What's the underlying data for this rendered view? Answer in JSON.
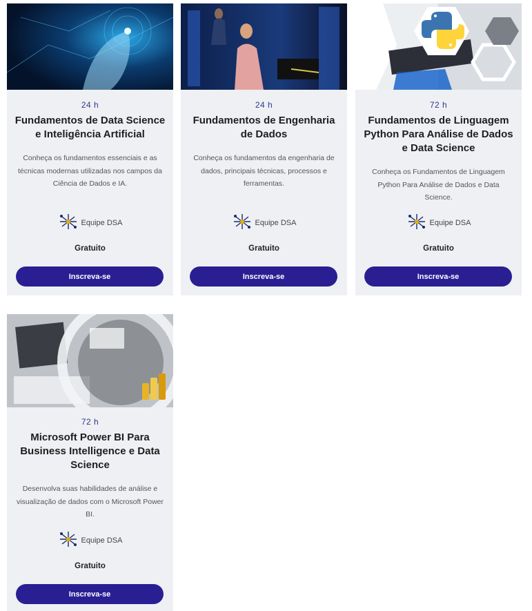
{
  "courses": [
    {
      "hours": "24 h",
      "title": "Fundamentos de Data Science e Inteligência Artificial",
      "description": "Conheça os fundamentos essenciais e as técnicas modernas utilizadas nos campos da Ciência de Dados e IA.",
      "author": "Equipe DSA",
      "price": "Gratuito",
      "cta": "Inscreva-se"
    },
    {
      "hours": "24 h",
      "title": "Fundamentos de Engenharia de Dados",
      "description": "Conheça os fundamentos da engenharia de dados, principais técnicas, processos e ferramentas.",
      "author": "Equipe DSA",
      "price": "Gratuito",
      "cta": "Inscreva-se"
    },
    {
      "hours": "72 h",
      "title": "Fundamentos de Linguagem Python Para Análise de Dados e Data Science",
      "description": "Conheça os Fundamentos de Linguagem Python Para Análise de Dados e Data Science.",
      "author": "Equipe DSA",
      "price": "Gratuito",
      "cta": "Inscreva-se"
    },
    {
      "hours": "72 h",
      "title": "Microsoft Power BI Para Business Intelligence e Data Science",
      "description": "Desenvolva suas habilidades de análise e visualização de dados com o Microsoft Power BI.",
      "author": "Equipe DSA",
      "price": "Gratuito",
      "cta": "Inscreva-se"
    }
  ],
  "colors": {
    "accent": "#291f93",
    "hours": "#2b3a8f",
    "card_bg": "#eff0f3"
  }
}
